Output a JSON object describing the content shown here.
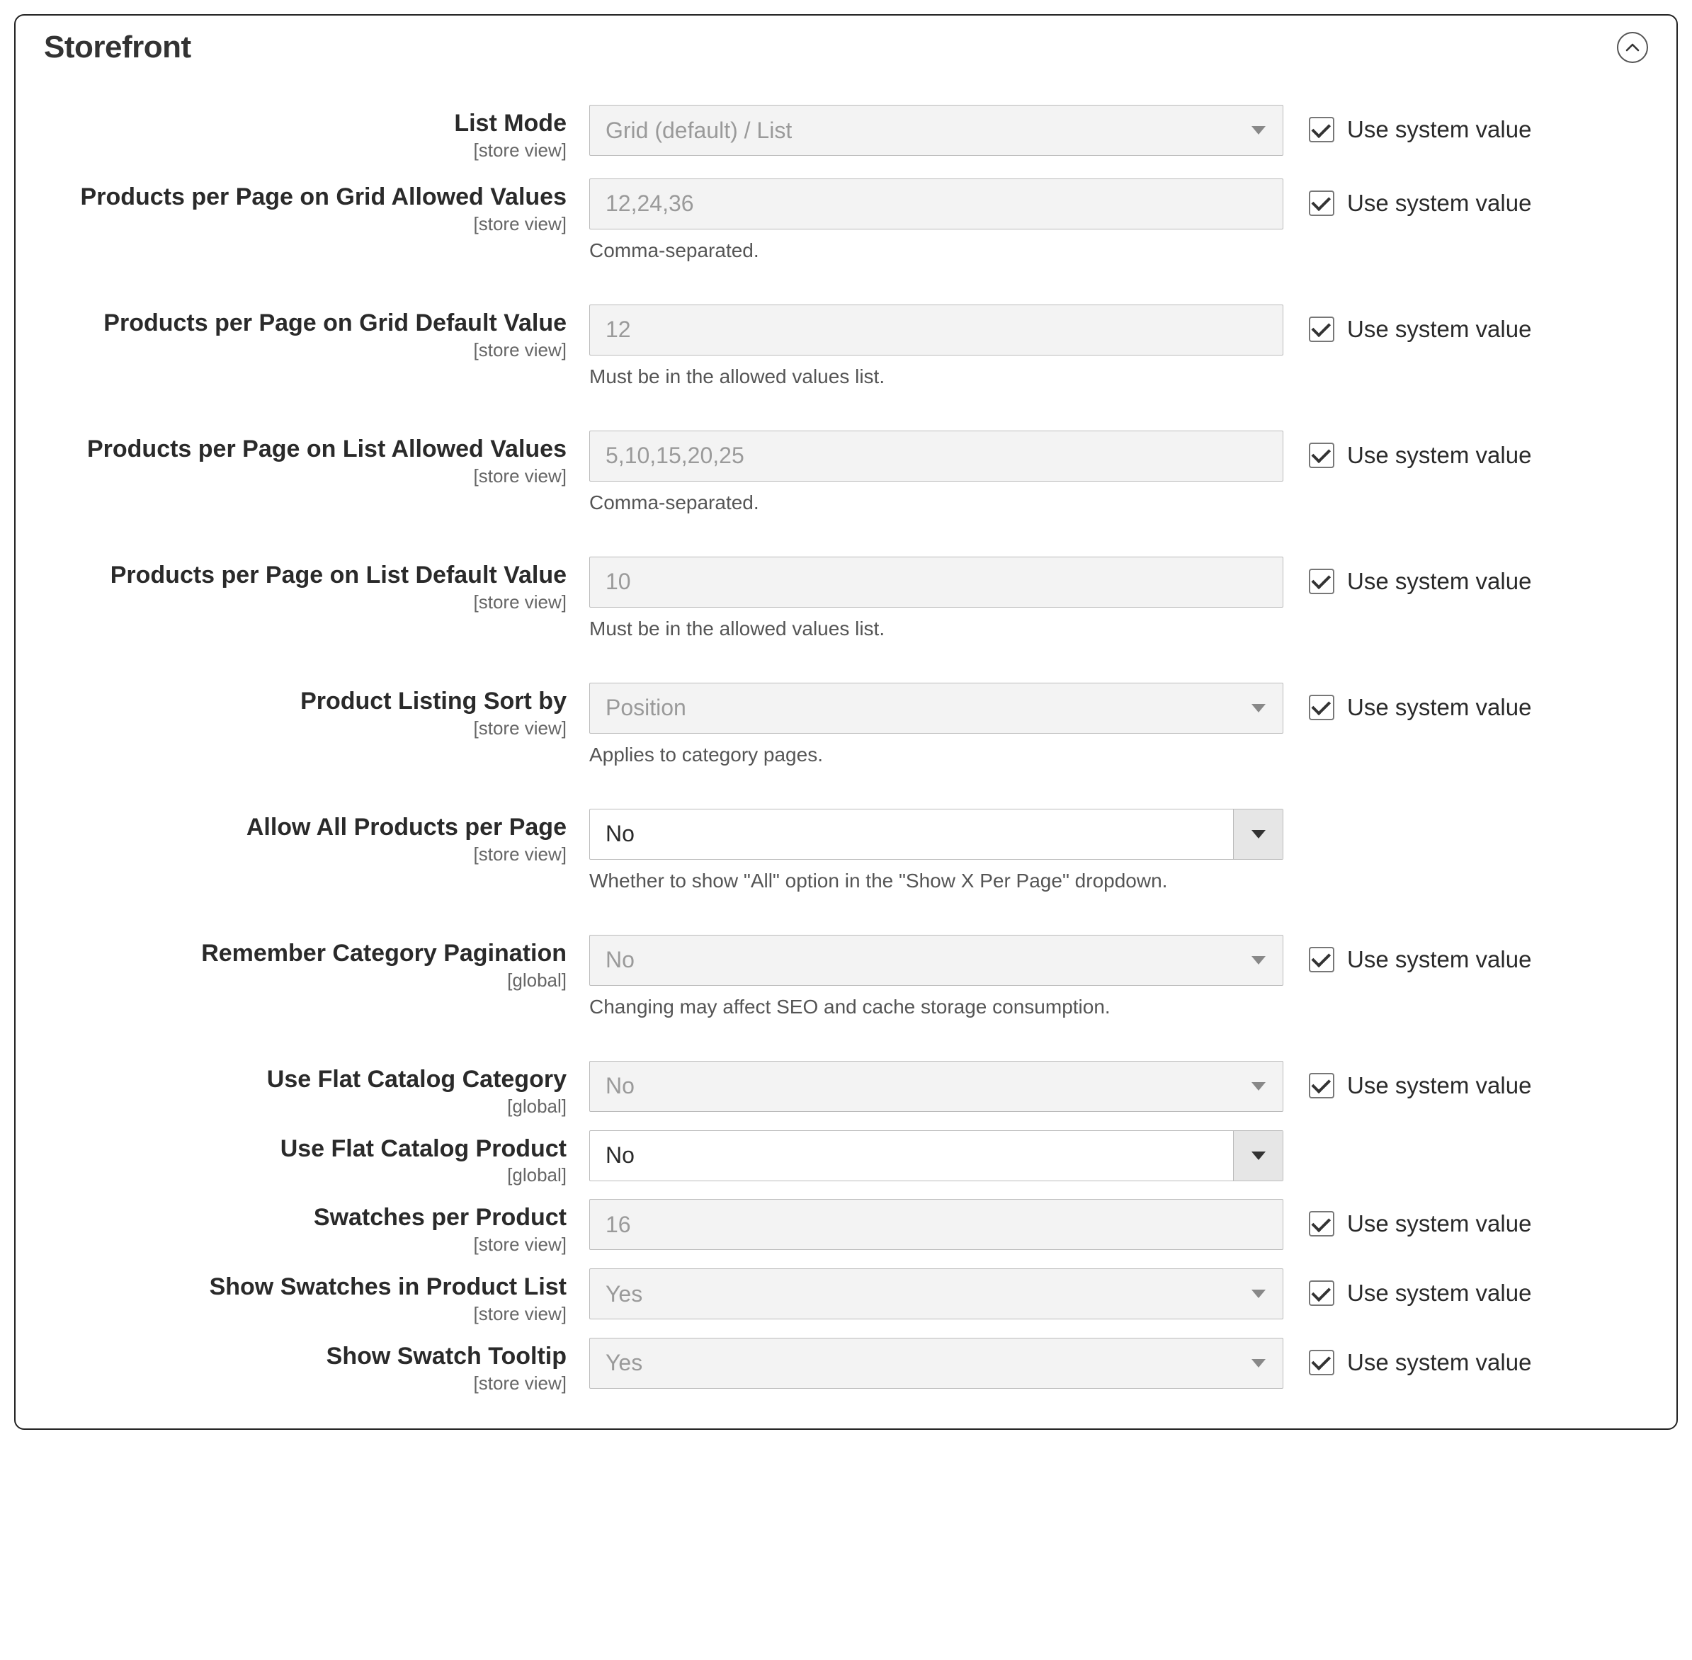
{
  "section": {
    "title": "Storefront"
  },
  "common": {
    "use_system_value": "Use system value",
    "scope_store": "[store view]",
    "scope_global": "[global]"
  },
  "fields": {
    "list_mode": {
      "label": "List Mode",
      "scope": "store",
      "type": "select",
      "value": "Grid (default) / List",
      "enabled": false,
      "note": "",
      "sys": true
    },
    "grid_allowed": {
      "label": "Products per Page on Grid Allowed Values",
      "scope": "store",
      "type": "text",
      "value": "12,24,36",
      "enabled": false,
      "note": "Comma-separated.",
      "sys": true
    },
    "grid_default": {
      "label": "Products per Page on Grid Default Value",
      "scope": "store",
      "type": "text",
      "value": "12",
      "enabled": false,
      "note": "Must be in the allowed values list.",
      "sys": true
    },
    "list_allowed": {
      "label": "Products per Page on List Allowed Values",
      "scope": "store",
      "type": "text",
      "value": "5,10,15,20,25",
      "enabled": false,
      "note": "Comma-separated.",
      "sys": true
    },
    "list_default": {
      "label": "Products per Page on List Default Value",
      "scope": "store",
      "type": "text",
      "value": "10",
      "enabled": false,
      "note": "Must be in the allowed values list.",
      "sys": true
    },
    "sort_by": {
      "label": "Product Listing Sort by",
      "scope": "store",
      "type": "select",
      "value": "Position",
      "enabled": false,
      "note": "Applies to category pages.",
      "sys": true
    },
    "allow_all": {
      "label": "Allow All Products per Page",
      "scope": "store",
      "type": "select",
      "value": "No",
      "enabled": true,
      "note": "Whether to show \"All\" option in the \"Show X Per Page\" dropdown.",
      "sys": false
    },
    "remember_pagination": {
      "label": "Remember Category Pagination",
      "scope": "global",
      "type": "select",
      "value": "No",
      "enabled": false,
      "note": "Changing may affect SEO and cache storage consumption.",
      "sys": true
    },
    "flat_category": {
      "label": "Use Flat Catalog Category",
      "scope": "global",
      "type": "select",
      "value": "No",
      "enabled": false,
      "note": "",
      "sys": true
    },
    "flat_product": {
      "label": "Use Flat Catalog Product",
      "scope": "global",
      "type": "select",
      "value": "No",
      "enabled": true,
      "note": "",
      "sys": false
    },
    "swatches_per_product": {
      "label": "Swatches per Product",
      "scope": "store",
      "type": "text",
      "value": "16",
      "enabled": false,
      "note": "",
      "sys": true
    },
    "show_swatches_list": {
      "label": "Show Swatches in Product List",
      "scope": "store",
      "type": "select",
      "value": "Yes",
      "enabled": false,
      "note": "",
      "sys": true
    },
    "show_swatch_tooltip": {
      "label": "Show Swatch Tooltip",
      "scope": "store",
      "type": "select",
      "value": "Yes",
      "enabled": false,
      "note": "",
      "sys": true
    }
  },
  "order": [
    "list_mode",
    "grid_allowed",
    "grid_default",
    "list_allowed",
    "list_default",
    "sort_by",
    "allow_all",
    "remember_pagination",
    "flat_category",
    "flat_product",
    "swatches_per_product",
    "show_swatches_list",
    "show_swatch_tooltip"
  ]
}
